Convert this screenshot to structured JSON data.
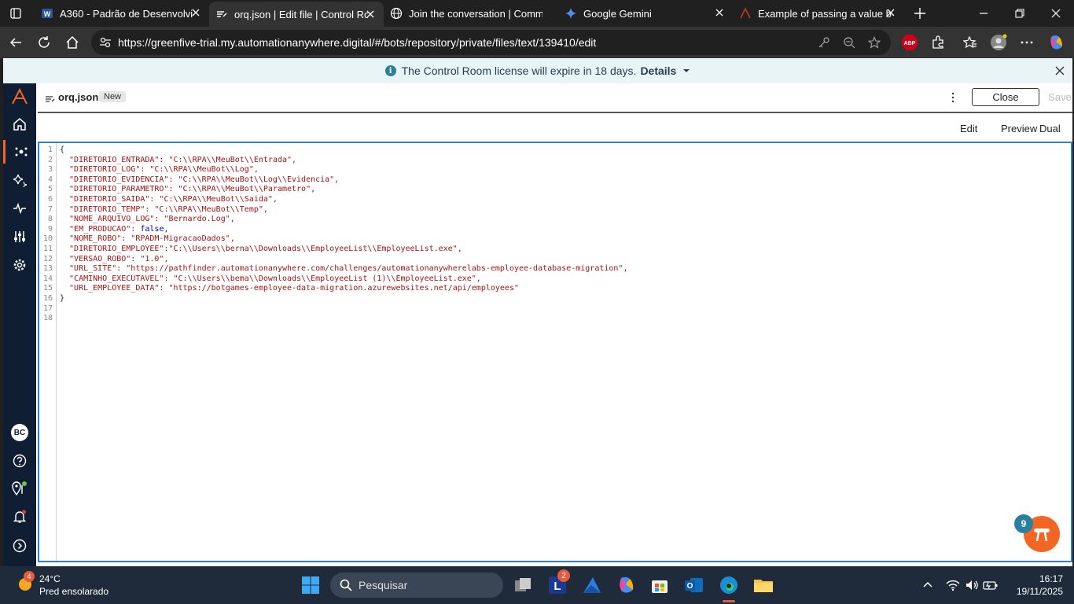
{
  "browser": {
    "tabs": [
      {
        "title": "A360 - Padrão de Desenvolvim",
        "icon": "word-icon"
      },
      {
        "title": "orq.json | Edit file | Control Ro",
        "icon": "automation-anywhere-icon"
      },
      {
        "title": "Join the conversation | Comm",
        "icon": "globe-icon"
      },
      {
        "title": "Google Gemini",
        "icon": "gemini-icon"
      },
      {
        "title": "Example of passing a value be",
        "icon": "automation-anywhere-icon"
      }
    ],
    "url": "https://greenfive-trial.my.automationanywhere.digital/#/bots/repository/private/files/text/139410/edit",
    "abp_label": "ABP"
  },
  "banner": {
    "message": "The Control Room license will expire in 18 days.",
    "details": "Details"
  },
  "sidebar": {
    "avatar_initials": "BC"
  },
  "header": {
    "filename": "orq.json",
    "badge": "New",
    "close_label": "Close",
    "save_label": "Save"
  },
  "modes": {
    "edit": "Edit",
    "preview": "Preview",
    "dual": "Dual"
  },
  "editor": {
    "line_numbers": [
      "1",
      "2",
      "3",
      "4",
      "5",
      "6",
      "7",
      "8",
      "9",
      "10",
      "11",
      "12",
      "13",
      "14",
      "15",
      "16",
      "17",
      "18"
    ],
    "lines": [
      "{",
      "  \"DIRETORIO_ENTRADA\": \"C:\\\\RPA\\\\MeuBot\\\\Entrada\",",
      "  \"DIRETORIO_LOG\": \"C:\\\\RPA\\\\MeuBot\\\\Log\",",
      "  \"DIRETORIO_EVIDENCIA\": \"C:\\\\RPA\\\\MeuBot\\\\Log\\\\Evidencia\",",
      "  \"DIRETORIO_PARAMETRO\": \"C:\\\\RPA\\\\MeuBot\\\\Parametro\",",
      "  \"DIRETORIO_SAIDA\": \"C:\\\\RPA\\\\MeuBot\\\\Saida\",",
      "  \"DIRETORIO_TEMP\": \"C:\\\\RPA\\\\MeuBot\\\\Temp\",",
      "  \"NOME_ARQUIVO_LOG\": \"Bernardo.Log\",",
      "  \"EM_PRODUCAO\": false,",
      "  \"NOME_ROBO\": \"RPADM-MigracaoDados\",",
      "  \"DIRETORIO_EMPLOYEE\":\"C:\\\\Users\\\\berna\\\\Downloads\\\\EmployeeList\\\\EmployeeList.exe\",",
      "  \"VERSAO_ROBO\": \"1.0\",",
      "  \"URL_SITE\": \"https://pathfinder.automationanywhere.com/challenges/automationanywherelabs-employee-database-migration\",",
      "  \"CAMINHO_EXECUTAVEL\": \"C:\\\\Users\\\\bema\\\\Downloads\\\\EmployeeList (1)\\\\EmployeeList.exe\",",
      "  \"URL_EMPLOYEE_DATA\": \"https://botgames-employee-data-migration.azurewebsites.net/api/employees\"",
      "}",
      "",
      ""
    ]
  },
  "help": {
    "badge_count": "9"
  },
  "taskbar": {
    "temperature": "24°C",
    "weather": "Pred ensolarado",
    "weather_badge": "4",
    "search_placeholder": "Pesquisar",
    "app_badge": "2",
    "time": "16:17",
    "date": "19/11/2025"
  },
  "colors": {
    "accent": "#2f7fd3",
    "sidebar": "#0f1e33",
    "fab": "#f26522",
    "string": "#a31515"
  }
}
